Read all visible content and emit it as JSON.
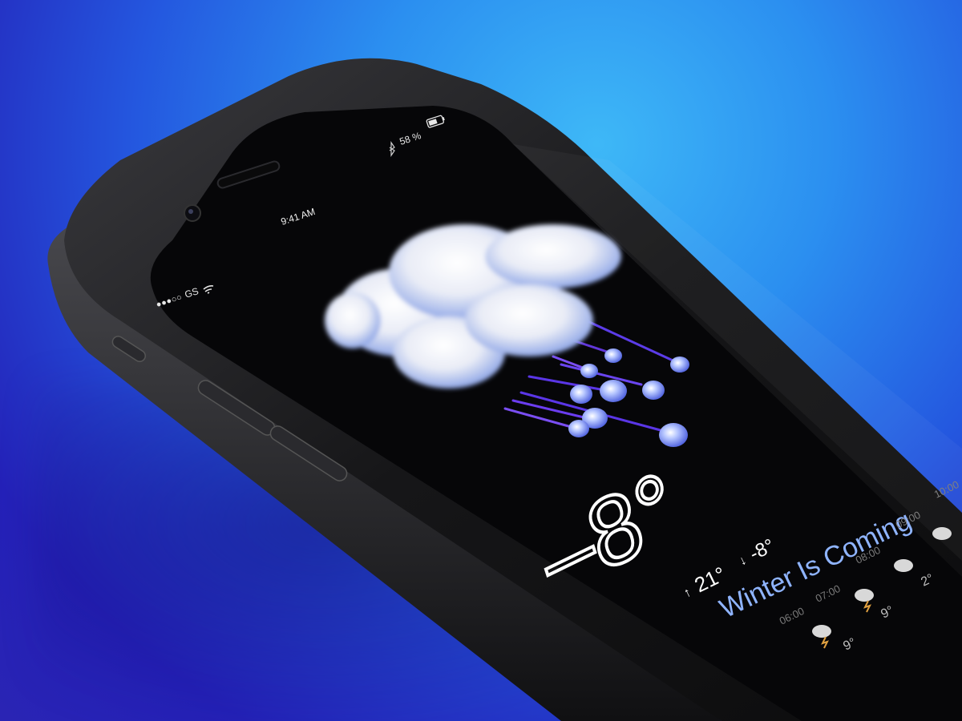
{
  "status_bar": {
    "carrier": "GS",
    "signal_dots": "●●●○○",
    "time": "9:41 AM",
    "battery_percent": "58 %"
  },
  "weather": {
    "current_temp": "–8°",
    "condition": "Winter Is Coming",
    "high": "21°",
    "low": "-8°",
    "high_arrow": "↑",
    "low_arrow": "↓"
  },
  "hourly": {
    "times": [
      "06:00",
      "07:00",
      "08:00",
      "09:00",
      "10:00"
    ],
    "temps": [
      "9°",
      "9°",
      "2°"
    ]
  },
  "colors": {
    "accent": "#8fb4ff",
    "background": "#2b8ff0",
    "phone_body": "#1a1a1c",
    "screen": "#050507"
  },
  "icons": [
    "wifi-icon",
    "bluetooth-icon",
    "battery-icon",
    "cloud-rain-icon",
    "storm-cloud-icon"
  ]
}
